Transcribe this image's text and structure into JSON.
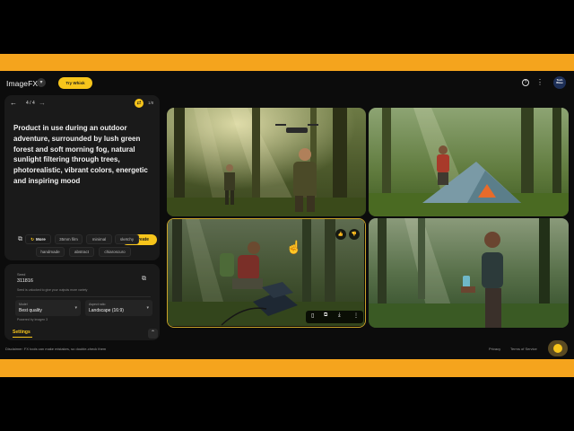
{
  "header": {
    "app_title": "ImageFX",
    "try_button": "Try Whisk",
    "avatar_text": "Tech Wave"
  },
  "prompt_panel": {
    "counter": "4 / 4",
    "badge": "1/8",
    "prompt": "Product in use during an outdoor adventure, surrounded by lush green forest and soft morning fog, natural sunlight filtering through trees, photorealistic, vibrant colors, energetic and inspiring mood",
    "create_button": "Create"
  },
  "chips": {
    "more": "More",
    "items": [
      "35mm film",
      "minimal",
      "sketchy",
      "handmade",
      "abstract",
      "chiaroscuro"
    ]
  },
  "settings": {
    "seed_label": "Seed",
    "seed_value": "311816",
    "seed_help": "Seed is unlocked to give your outputs more variety",
    "model_label": "Model",
    "model_value": "Best quality",
    "aspect_label": "Aspect ratio",
    "aspect_value": "Landscape (16:9)",
    "powered_by": "Powered by Imagen 3",
    "tab_label": "Settings"
  },
  "gallery": {
    "images": [
      {
        "subject": "drone-in-forest"
      },
      {
        "subject": "camping-tent"
      },
      {
        "subject": "solar-panel-kneeling",
        "selected": true
      },
      {
        "subject": "water-bottle-runner"
      }
    ]
  },
  "footer": {
    "disclaimer": "Disclaimer: FX tools can make mistakes, so double-check them",
    "privacy": "Privacy",
    "terms": "Terms of Service"
  },
  "colors": {
    "accent": "#f7c51b",
    "frame": "#f5a41d",
    "background": "#0c0c0c",
    "panel": "#1a1a1a"
  }
}
